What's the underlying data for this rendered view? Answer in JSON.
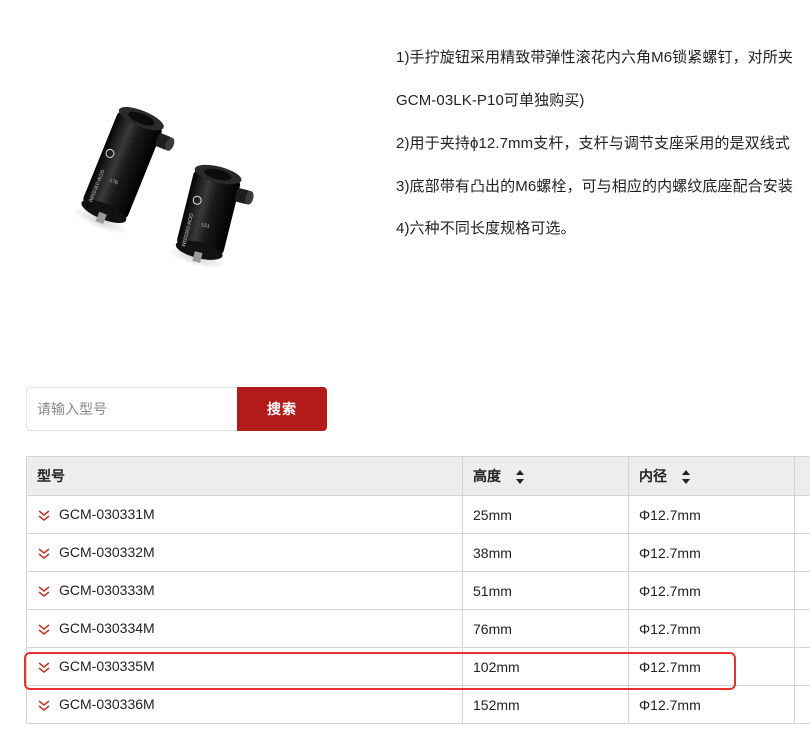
{
  "description": [
    "1)手拧旋钮采用精致带弹性滚花内六角M6锁紧螺钉，对所夹",
    "GCM-03LK-P10可单独购买)",
    "2)用于夹持ϕ12.7mm支杆，支杆与调节支座采用的是双线式",
    "3)底部带有凸出的M6螺栓，可与相应的内螺纹底座配合安装",
    "4)六种不同长度规格可选。"
  ],
  "product_image": {
    "left_post_label": "GCM-030334M",
    "left_post_sublabel": "L76",
    "right_post_label": "GCM-030333M",
    "right_post_sublabel": "L51"
  },
  "search": {
    "placeholder": "请输入型号",
    "value": "",
    "button_label": "搜索"
  },
  "table": {
    "headers": {
      "model": "型号",
      "height": "高度",
      "inner_diameter": "内径"
    },
    "rows": [
      {
        "model": "GCM-030331M",
        "height": "25mm",
        "inner_diameter": "Φ12.7mm"
      },
      {
        "model": "GCM-030332M",
        "height": "38mm",
        "inner_diameter": "Φ12.7mm"
      },
      {
        "model": "GCM-030333M",
        "height": "51mm",
        "inner_diameter": "Φ12.7mm"
      },
      {
        "model": "GCM-030334M",
        "height": "76mm",
        "inner_diameter": "Φ12.7mm"
      },
      {
        "model": "GCM-030335M",
        "height": "102mm",
        "inner_diameter": "Φ12.7mm",
        "highlighted": true
      },
      {
        "model": "GCM-030336M",
        "height": "152mm",
        "inner_diameter": "Φ12.7mm"
      }
    ]
  },
  "colors": {
    "accent": "#b31b1b",
    "highlight_border": "#e5322d",
    "header_bg": "#ededed",
    "toggle_icon": "#c0392b"
  },
  "icons": {
    "row_toggle": "double-chevron-down-icon",
    "sort": "sort-up-down-icon"
  }
}
